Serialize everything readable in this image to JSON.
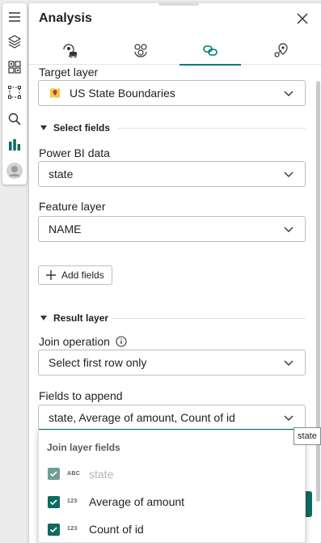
{
  "toolbar": {
    "tools": [
      {
        "name": "menu-icon"
      },
      {
        "name": "layers-icon"
      },
      {
        "name": "basemap-icon"
      },
      {
        "name": "select-icon"
      },
      {
        "name": "search-icon"
      },
      {
        "name": "analysis-icon"
      },
      {
        "name": "user-avatar-icon"
      }
    ]
  },
  "panel": {
    "title": "Analysis",
    "tabs": [
      {
        "name": "tab-drive-time",
        "icon": "car-location-icon",
        "active": false
      },
      {
        "name": "tab-cluster",
        "icon": "cluster-icon",
        "active": false
      },
      {
        "name": "tab-join",
        "icon": "join-icon",
        "active": true
      },
      {
        "name": "tab-location",
        "icon": "location-pins-icon",
        "active": false
      }
    ]
  },
  "form": {
    "target_layer_label": "Target layer",
    "target_layer_value": "US State Boundaries",
    "select_fields_label": "Select fields",
    "powerbi_label": "Power BI data",
    "powerbi_value": "state",
    "feature_layer_label": "Feature layer",
    "feature_layer_value": "NAME",
    "add_fields_label": "Add fields",
    "result_layer_label": "Result layer",
    "join_operation_label": "Join operation",
    "join_operation_value": "Select first row only",
    "fields_to_append_label": "Fields to append",
    "fields_to_append_value": "state, Average of amount, Count of id"
  },
  "dropdown": {
    "header": "Join layer fields",
    "items": [
      {
        "type": "ABC",
        "label": "state",
        "checked": true,
        "disabled": true
      },
      {
        "type": "123",
        "label": "Average of amount",
        "checked": true,
        "disabled": false
      },
      {
        "type": "123",
        "label": "Count of id",
        "checked": true,
        "disabled": false
      }
    ]
  },
  "tooltip": "state",
  "colors": {
    "accent": "#007a78",
    "checkbox": "#0d6b5f",
    "layer_icon": "#f2c94c"
  }
}
